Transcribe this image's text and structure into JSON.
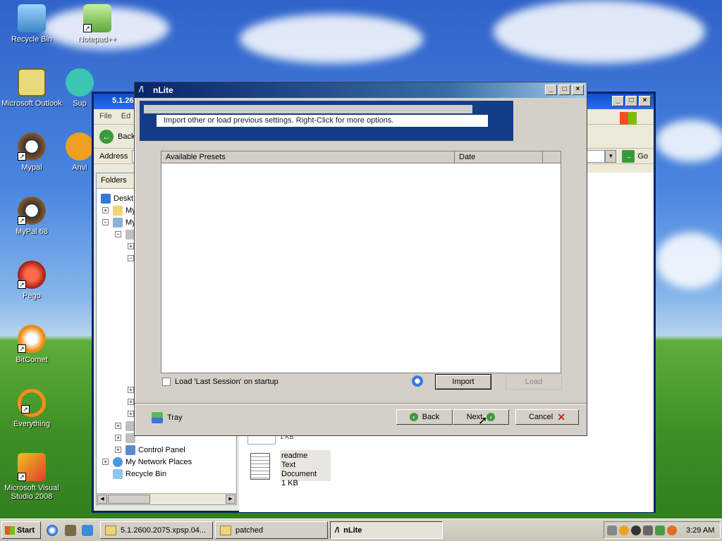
{
  "desktop": {
    "icons": [
      {
        "label": "Recycle Bin",
        "icon": "recycle-bin-icon"
      },
      {
        "label": "Notepad++",
        "icon": "notepad-plus-plus-icon"
      },
      {
        "label": "Microsoft Outlook",
        "icon": "outlook-icon"
      },
      {
        "label": "Sup",
        "icon": "support-icon"
      },
      {
        "label": "Mypal",
        "icon": "mypal-icon"
      },
      {
        "label": "Anvi",
        "icon": "anvi-icon"
      },
      {
        "label": "MyPal 68",
        "icon": "mypal68-icon"
      },
      {
        "label": "Pego",
        "icon": "pego-icon"
      },
      {
        "label": "BitComet",
        "icon": "bitcomet-icon"
      },
      {
        "label": "Everything",
        "icon": "everything-icon"
      },
      {
        "label": "Microsoft Visual Studio 2008",
        "icon": "visual-studio-icon"
      }
    ]
  },
  "explorer": {
    "title": "5.1.26",
    "menu": [
      "File",
      "Ed"
    ],
    "back_label": "Back",
    "address_label": "Address",
    "go_label": "Go",
    "folders_label": "Folders",
    "tree": [
      {
        "label": "Deskt",
        "indent": 0
      },
      {
        "label": "My",
        "indent": 1
      },
      {
        "label": "My",
        "indent": 1
      },
      {
        "label": "",
        "indent": 2
      },
      {
        "label": "",
        "indent": 3
      },
      {
        "label": "",
        "indent": 3
      },
      {
        "label": "Control Panel",
        "indent": 2
      },
      {
        "label": "My Network Places",
        "indent": 1
      },
      {
        "label": "Recycle Bin",
        "indent": 1
      }
    ],
    "file": {
      "name": "readme",
      "type": "Text Document",
      "size": "1 KB"
    },
    "file_partial_size": "1 KB"
  },
  "nlite": {
    "title": "nLite",
    "banner_text": "Import other or load previous settings. Right-Click for more options.",
    "columns": [
      "Available Presets",
      "Date"
    ],
    "checkbox_label": "Load 'Last Session' on startup",
    "import_label": "Import",
    "load_label": "Load",
    "tray_label": "Tray",
    "back_label": "Back",
    "next_label": "Next",
    "cancel_label": "Cancel"
  },
  "taskbar": {
    "start_label": "Start",
    "tasks": [
      {
        "label": "5.1.2600.2075.xpsp.04..."
      },
      {
        "label": "patched"
      },
      {
        "label": "nLite"
      }
    ],
    "clock": "3:29 AM"
  },
  "colors": {
    "title_active": "#0a246a",
    "banner": "#133d86",
    "face": "#d4d0c8"
  }
}
